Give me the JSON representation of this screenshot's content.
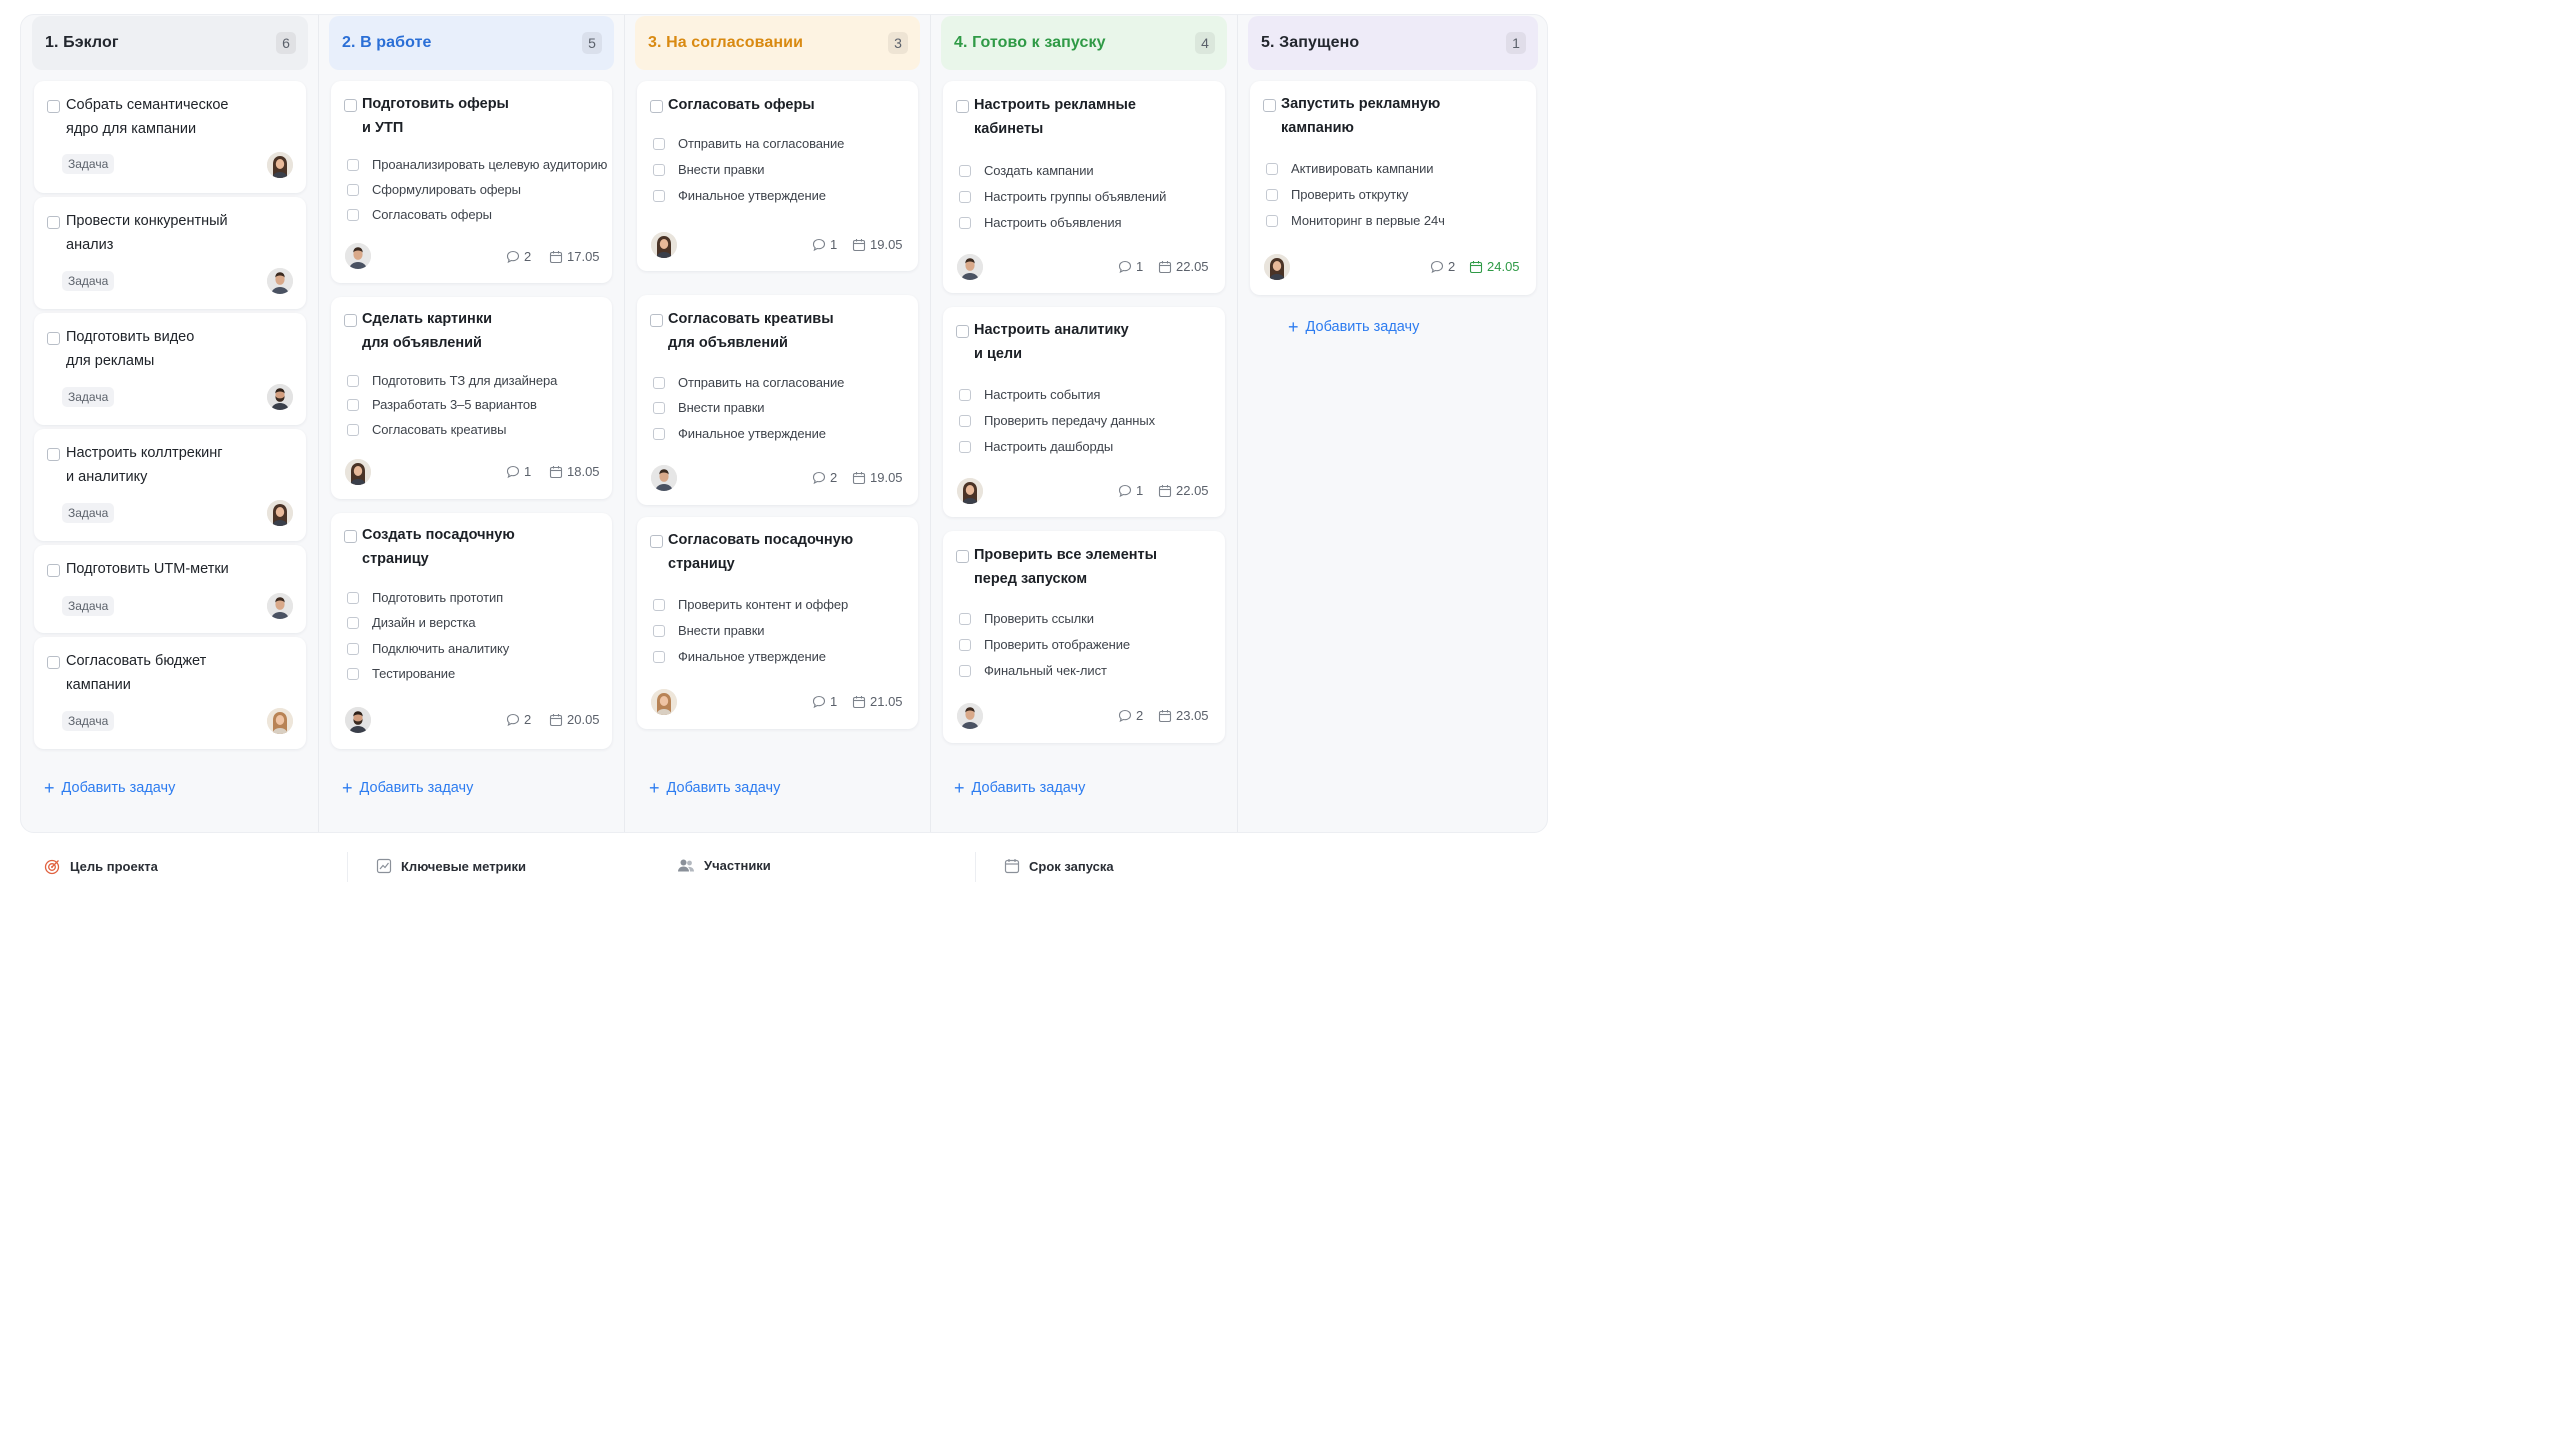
{
  "columns": [
    {
      "title": "1. Бэклог",
      "count": "6",
      "header_bg": "#eef0f3",
      "title_color": "#23272e",
      "cards": [
        {
          "title_lines": [
            "Собрать семантическое",
            "ядро для кампании"
          ],
          "tag": "Задача",
          "avatar": "female"
        },
        {
          "title_lines": [
            "Провести конкурентный",
            "анализ"
          ],
          "tag": "Задача",
          "avatar": "male"
        },
        {
          "title_lines": [
            "Подготовить видео",
            "для рекламы"
          ],
          "tag": "Задача",
          "avatar": "male-beard"
        },
        {
          "title_lines": [
            "Настроить коллтрекинг",
            "и аналитику"
          ],
          "tag": "Задача",
          "avatar": "female"
        },
        {
          "title_lines": [
            "Подготовить UTM-метки"
          ],
          "tag": "Задача",
          "avatar": "male"
        },
        {
          "title_lines": [
            "Согласовать бюджет",
            "кампании"
          ],
          "tag": "Задача",
          "avatar": "female-blonde"
        }
      ],
      "add_label": "Добавить задачу"
    },
    {
      "title": "2. В работе",
      "count": "5",
      "header_bg": "#e8effb",
      "title_color": "#2b6fd6",
      "cards": [
        {
          "title_lines": [
            "Подготовить оферы",
            "и УТП"
          ],
          "subtasks": [
            "Проанализировать целевую аудиторию",
            "Сформулировать оферы",
            "Согласовать оферы"
          ],
          "comments": "2",
          "date": "17.05",
          "avatar": "male"
        },
        {
          "title_lines": [
            "Сделать картинки",
            "для объявлений"
          ],
          "subtasks": [
            "Подготовить ТЗ для дизайнера",
            "Разработать 3–5 вариантов",
            "Согласовать креативы"
          ],
          "comments": "1",
          "date": "18.05",
          "avatar": "female"
        },
        {
          "title_lines": [
            "Создать посадочную",
            "страницу"
          ],
          "subtasks": [
            "Подготовить прототип",
            "Дизайн и верстка",
            "Подключить аналитику",
            "Тестирование"
          ],
          "comments": "2",
          "date": "20.05",
          "avatar": "male-beard"
        }
      ],
      "add_label": "Добавить задачу"
    },
    {
      "title": "3. На согласовании",
      "count": "3",
      "header_bg": "#fdf3e2",
      "title_color": "#d98a12",
      "cards": [
        {
          "title_lines": [
            "Согласовать оферы"
          ],
          "subtasks": [
            "Отправить на согласование",
            "Внести правки",
            "Финальное утверждение"
          ],
          "comments": "1",
          "date": "19.05",
          "avatar": "female"
        },
        {
          "title_lines": [
            "Согласовать креативы",
            "для объявлений"
          ],
          "subtasks": [
            "Отправить на согласование",
            "Внести правки",
            "Финальное утверждение"
          ],
          "comments": "2",
          "date": "19.05",
          "avatar": "male"
        },
        {
          "title_lines": [
            "Согласовать посадочную",
            "страницу"
          ],
          "subtasks": [
            "Проверить контент и оффер",
            "Внести правки",
            "Финальное утверждение"
          ],
          "comments": "1",
          "date": "21.05",
          "avatar": "female-blonde"
        }
      ],
      "add_label": "Добавить задачу"
    },
    {
      "title": "4. Готово к запуску",
      "count": "4",
      "header_bg": "#e9f6ea",
      "title_color": "#2f9a46",
      "cards": [
        {
          "title_lines": [
            "Настроить рекламные",
            "кабинеты"
          ],
          "subtasks": [
            "Создать кампании",
            "Настроить группы объявлений",
            "Настроить объявления"
          ],
          "comments": "1",
          "date": "22.05",
          "avatar": "male"
        },
        {
          "title_lines": [
            "Настроить аналитику",
            "и цели"
          ],
          "subtasks": [
            "Настроить события",
            "Проверить передачу данных",
            "Настроить дашборды"
          ],
          "comments": "1",
          "date": "22.05",
          "avatar": "female"
        },
        {
          "title_lines": [
            "Проверить все элементы",
            "перед запуском"
          ],
          "subtasks": [
            "Проверить ссылки",
            "Проверить отображение",
            "Финальный чек-лист"
          ],
          "comments": "2",
          "date": "23.05",
          "avatar": "male"
        }
      ],
      "add_label": "Добавить задачу"
    },
    {
      "title": "5. Запущено",
      "count": "1",
      "header_bg": "#eeebf8",
      "title_color": "#23272e",
      "cards": [
        {
          "title_lines": [
            "Запустить рекламную",
            "кампанию"
          ],
          "subtasks": [
            "Активировать кампании",
            "Проверить открутку",
            "Мониторинг в первые 24ч"
          ],
          "comments": "2",
          "date": "24.05",
          "date_color": "#2f9a46",
          "avatar": "female"
        }
      ],
      "add_label": "Добавить задачу"
    }
  ],
  "footer": {
    "goal": "Цель проекта",
    "metrics": "Ключевые метрики",
    "members": "Участники",
    "deadline": "Срок запуска"
  },
  "colors": {
    "accent": "#2d7cf0",
    "green": "#2f9a46"
  }
}
